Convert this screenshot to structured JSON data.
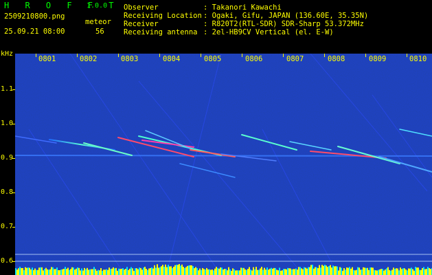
{
  "header": {
    "app_name": "H R O F F T",
    "version": "1.0.0",
    "filename": "2509210800.png",
    "datetime": "25.09.21 08:00",
    "meteor_label": "meteor",
    "meteor_count": "56",
    "info": [
      {
        "key": "Observer",
        "value": ": Takanori Kawachi"
      },
      {
        "key": "Receiving Location",
        "value": ": Ogaki, Gifu, JAPAN (136.60E, 35.35N)"
      },
      {
        "key": "Receiver",
        "value": ": R820T2(RTL-SDR) SDR-Sharp 53.372MHz"
      },
      {
        "key": "Receiving antenna",
        "value": ": 2el-HB9CV Vertical (el. E-W)"
      }
    ]
  },
  "axis": {
    "y_unit": "kHz",
    "y_labels": [
      "1.1",
      "1.0",
      "0.9",
      "0.8",
      "0.7",
      "0.6"
    ],
    "x_labels": [
      "0801",
      "0802",
      "0803",
      "0804",
      "0805",
      "0806",
      "0807",
      "0808",
      "0809",
      "0810"
    ]
  },
  "colors": {
    "label": "#ffff00",
    "logo": "#00ff00",
    "background": "#000000",
    "noise": "#0a1a78"
  }
}
